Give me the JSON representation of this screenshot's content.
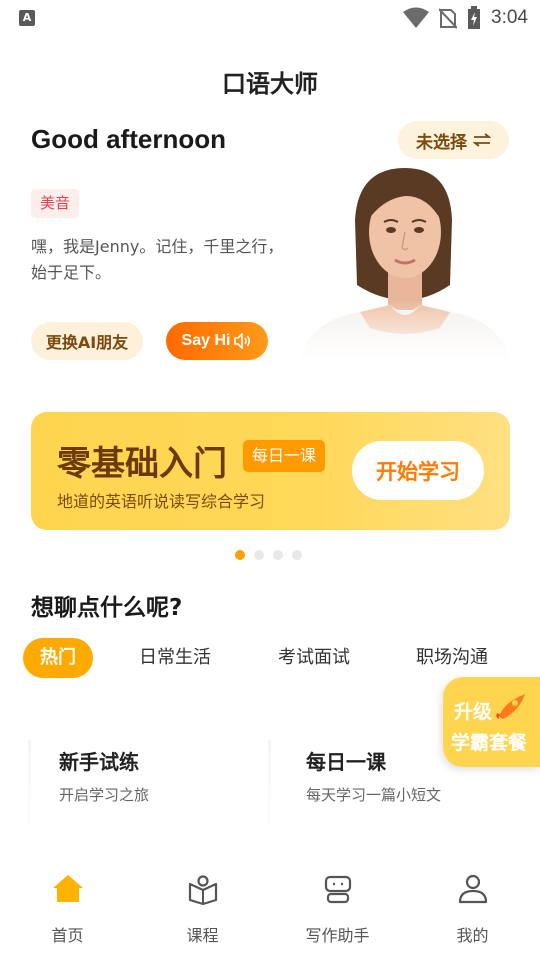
{
  "status_bar": {
    "time": "3:04",
    "notification_letter": "A"
  },
  "app": {
    "title": "口语大师"
  },
  "greeting": {
    "text": "Good afternoon",
    "selector_label": "未选择",
    "accent_tag": "美音",
    "intro": "嘿，我是Jenny。记住，千里之行，始于足下。",
    "change_button": "更换AI朋友",
    "say_hi_button": "Say Hi"
  },
  "banner": {
    "title": "零基础入门",
    "badge": "每日一课",
    "subtitle": "地道的英语听说读写综合学习",
    "button": "开始学习",
    "page_count": 4,
    "active_page": 1
  },
  "topics": {
    "title": "想聊点什么呢?",
    "tabs": [
      "热门",
      "日常生活",
      "考试面试",
      "职场沟通"
    ],
    "active_tab": "热门"
  },
  "upgrade": {
    "line1": "升级",
    "line2": "学霸套餐"
  },
  "cards": [
    {
      "title": "新手试练",
      "subtitle": "开启学习之旅"
    },
    {
      "title": "每日一课",
      "subtitle": "每天学习一篇小短文"
    }
  ],
  "bottom_nav": [
    {
      "label": "首页",
      "icon": "home-icon",
      "active": true
    },
    {
      "label": "课程",
      "icon": "course-book-icon",
      "active": false
    },
    {
      "label": "写作助手",
      "icon": "robot-icon",
      "active": false
    },
    {
      "label": "我的",
      "icon": "profile-icon",
      "active": false
    }
  ],
  "colors": {
    "accent": "#ffaa00",
    "banner": "#ffd54f",
    "say_hi_start": "#ff6a00",
    "say_hi_end": "#ff9a1a"
  }
}
